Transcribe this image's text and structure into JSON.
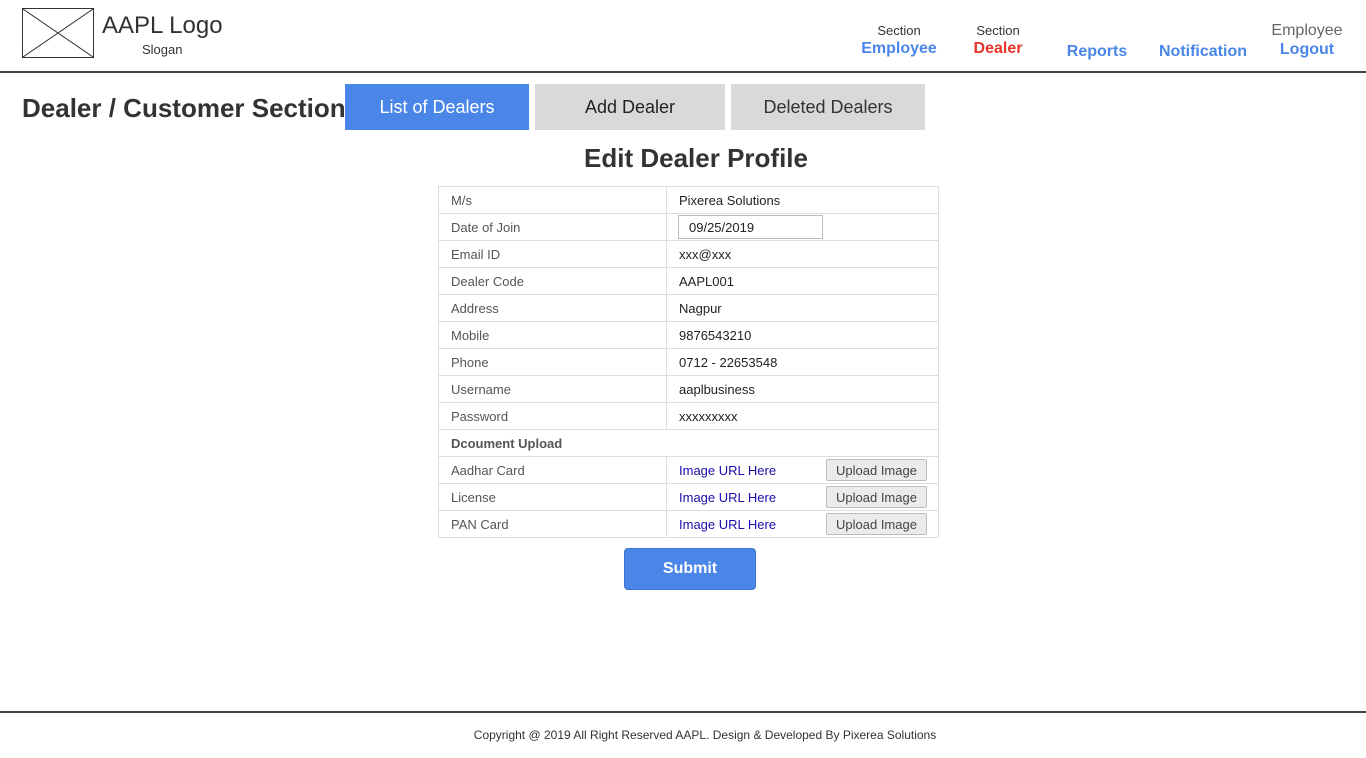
{
  "header": {
    "logo_text": "AAPL Logo",
    "slogan": "Slogan"
  },
  "nav": {
    "employee": {
      "small": "Section",
      "label": "Employee"
    },
    "dealer": {
      "small": "Section",
      "label": "Dealer"
    },
    "reports": {
      "label": "Reports"
    },
    "notification": {
      "label": "Notification"
    },
    "logout": {
      "small": "Employee",
      "label": "Logout"
    },
    "active_color": "#e8342a",
    "link_color": "#4a86e8"
  },
  "section": {
    "title": "Dealer / Customer Section",
    "tabs": [
      {
        "label": "List of Dealers",
        "active": true
      },
      {
        "label": "Add Dealer",
        "active": false
      },
      {
        "label": "Deleted Dealers",
        "active": false
      }
    ]
  },
  "form": {
    "title": "Edit Dealer Profile",
    "rows": [
      {
        "label": "M/s",
        "value": "Pixerea Solutions"
      },
      {
        "label": "Date of Join",
        "value": "09/25/2019"
      },
      {
        "label": "Email ID",
        "value": "xxx@xxx"
      },
      {
        "label": "Dealer Code",
        "value": "AAPL001"
      },
      {
        "label": "Address",
        "value": "Nagpur"
      },
      {
        "label": "Mobile",
        "value": "9876543210"
      },
      {
        "label": "Phone",
        "value": "0712 - 22653548"
      },
      {
        "label": "Username",
        "value": "aaplbusiness"
      },
      {
        "label": "Password",
        "value": "xxxxxxxxx"
      }
    ],
    "document_group": "Dcoument Upload",
    "documents": [
      {
        "label": "Aadhar Card",
        "link": "Image URL Here",
        "button": "Upload Image"
      },
      {
        "label": "License",
        "link": "Image URL Here",
        "button": "Upload Image"
      },
      {
        "label": "PAN Card",
        "link": "Image URL Here",
        "button": "Upload Image"
      }
    ],
    "submit_label": "Submit"
  },
  "footer": {
    "text": "Copyright @ 2019 All Right Reserved AAPL. Design & Developed By Pixerea Solutions"
  }
}
